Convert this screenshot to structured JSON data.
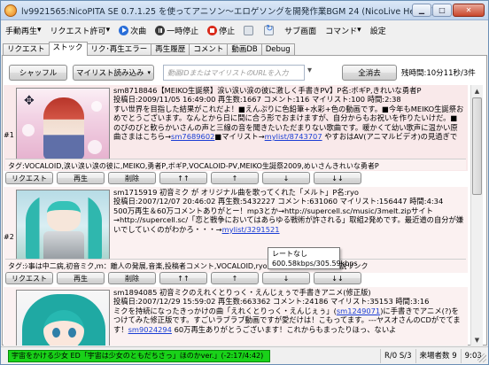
{
  "window": {
    "title": "lv9921565:NicoPITA SE 0.7.1.25 を使ってアニソン～エロゲソングを開発作業BGM 24 (NicoLive Helper)"
  },
  "menu": {
    "items": [
      "手動再生",
      "リクエスト許可",
      "次曲",
      "一時停止",
      "停止",
      "サブ画面",
      "コマンド",
      "設定"
    ],
    "has_dropdown": [
      true,
      true,
      false,
      false,
      false,
      false,
      true,
      false
    ]
  },
  "tabs": [
    "リクエスト",
    "ストック",
    "リク･再生エラー",
    "再生履歴",
    "コメント",
    "動画DB",
    "Debug"
  ],
  "active_tab": 1,
  "toolbar": {
    "shuffle": "シャッフル",
    "mylist": "マイリスト読み込み",
    "url_placeholder": "動画IDまたはマイリストのURLを入力",
    "clear": "全消去",
    "remaining": "残時間:10分11秒/3件"
  },
  "items": [
    {
      "num": "#1",
      "title": "sm8718846【MEIKO生誕祭】涙い涙い涙の彼に激しく手書きPV】P名:ボギP,きれいな勇者P",
      "meta": "投稿日:2009/11/05 16:49:00 再生数:1667 コメント:116 マイリスト:100 時間:2:38",
      "desc": "すい世界を目指した結果がこれだよ！■えんぷりに色鉛筆+水彩+色の動画です。■今年もMEIKO生誕祭おめでとうございます。なんとから日に間に合う形でおまけますが、自分からもお祝いを作りたいけだ。■のびのびと軟らかいさんの声と三線の音を聞きたいただまりない歌曲です。暖かくて幼い歌声に温かい原曲さまはこちら→",
      "link1": "sm7689602",
      "desc2": "■マイリスト→",
      "link2": "mylist/8743707",
      "desc3": " やすおはAV(アニマルビデオ)の見過ぎで迷駆するそうです。",
      "tags": "タグ:VOCALOID,涙い涙い涙の彼に,MEIKO,勇者P,ボギP,VOCALOID-PV,MEIKO生誕祭2009,めいさんきれいな勇者P",
      "buttons": [
        "リクエスト",
        "再生",
        "削除",
        "↑↑",
        "↑",
        "↓",
        "↓↓"
      ]
    },
    {
      "num": "#2",
      "title": "sm1715919 初音ミク が オリジナル曲を歌ってくれた「メルト」P名:ryo",
      "meta": "投稿日:2007/12/07 20:46:02 再生数:5432227 コメント:631060 マイリスト:156447 時間:4:34",
      "desc": "500万再生＆60万コメントありがとー！mp3とか→http://supercell.sc/music/3melt.zipサイト→http://supercell.sc/「恋と戦争においてはあらゆる戦術が許される」取組2発めです。最近道の自分が嫌いでしていくのがわかろ・・・→",
      "link1": "mylist/3291521",
      "desc2": "",
      "link2": "",
      "desc3": "",
      "tags": "タグ:ｼ事は中二病,初音ミク,ｍ：離人の発展,音楽,投稿者コメント,VOCALOID,ryo,メルト,VOCARIOの伝説リンク",
      "buttons": [
        "リクエスト",
        "再生",
        "削除",
        "↑↑",
        "↑",
        "↓",
        "↓↓"
      ]
    },
    {
      "num": "#3",
      "title": "sm1894085 初音ミクのえれくとりっく・えんじぇぅで手書きアニメ(修正版)",
      "meta": "投稿日:2007/12/29 15:59:02 再生数:663362 コメント:24186 マイリスト:35153 時間:3:16",
      "desc": "ミクを持続になったきっかけの曲「えれくとりっく・えんじぇぅ」(",
      "link1": "sm1249071",
      "desc2": ")に手書きでアニメ(?)をつけてみた修正版です。すごいラブラブ動画ですが愛だけは！こもってます。---ヤスオさんのCDがでてます！",
      "link2": "sm9024294",
      "desc3": " 60万再生ありがとうございます！これからもまったりほっ、ないよ",
      "tags": "",
      "buttons": []
    }
  ],
  "tooltip": {
    "line1": "レートなし",
    "line2": "600.58kbps/305.59kbps"
  },
  "status": {
    "now_playing": "宇宙をかける少女 ED「宇宙は少女のともだちさっ」ほのかver.」(-2:17/4:42)",
    "rs": "R/0 S/3",
    "visitors": "来場者数 9",
    "time": "9:03"
  }
}
